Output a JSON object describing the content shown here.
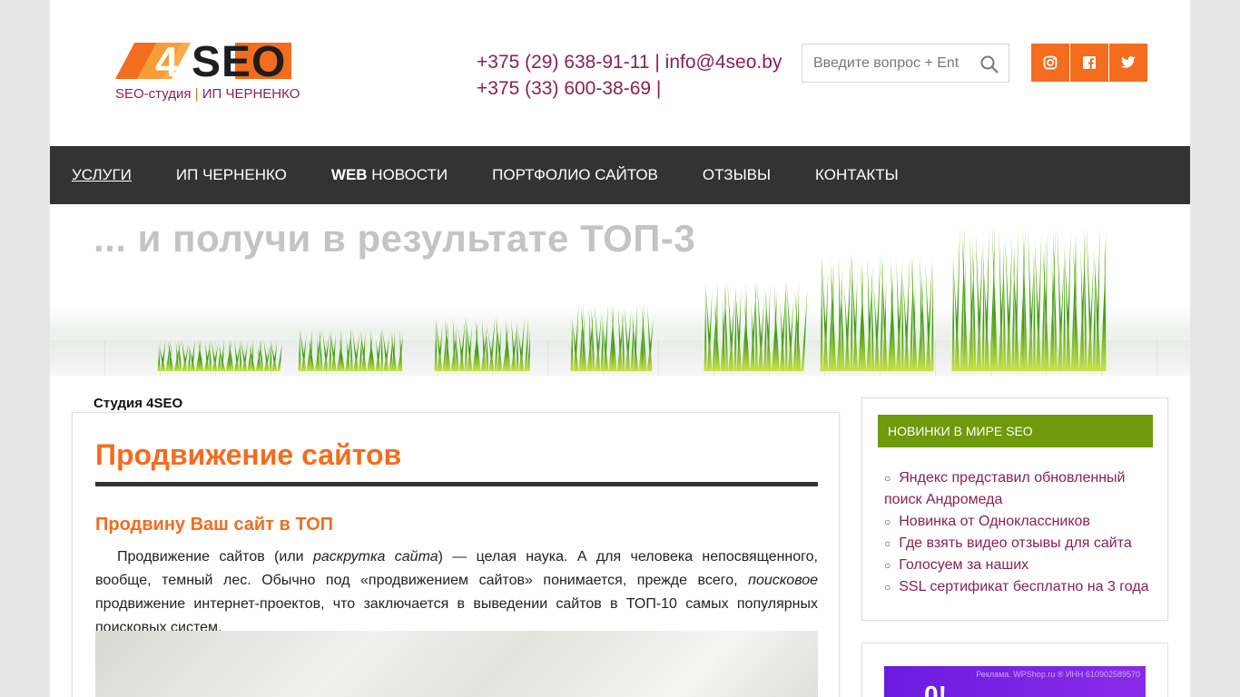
{
  "header": {
    "logo_sub_left": "SEO-студия",
    "logo_sub_sep": "|",
    "logo_sub_right": "ИП ЧЕРНЕНКО",
    "phone1": "+375 (29) 638-91-11",
    "email": "info@4seo.by",
    "phone2": "+375 (33) 600-38-69",
    "pipe": "|",
    "search_placeholder": "Введите вопрос + Ent",
    "social": [
      "instagram-icon",
      "facebook-icon",
      "twitter-icon"
    ],
    "accent_color": "#f46c1e",
    "link_color": "#8c1f55"
  },
  "nav": {
    "items": [
      {
        "label": "УСЛУГИ"
      },
      {
        "label": "ИП ЧЕРНЕНКО"
      },
      {
        "label_bold": "WEB",
        "label": " НОВОСТИ"
      },
      {
        "label": "ПОРТФОЛИО САЙТОВ"
      },
      {
        "label": "ОТЗЫВЫ"
      },
      {
        "label": "КОНТАКТЫ"
      }
    ],
    "background": "#333333"
  },
  "banner": {
    "text": "... и получи в результате ТОП-3"
  },
  "main": {
    "breadcrumb": "Студия 4SEO",
    "title": "Продвижение сайтов",
    "subtitle": "Продвину Ваш сайт в ТОП",
    "para_1": "Продвижение сайтов (или ",
    "para_em1": "раскрутка сайта",
    "para_2": ") — целая наука. А для человека непосвященного, вообще, темный лес. Обычно под «продвижением сайтов» понимается, прежде всего, ",
    "para_em2": "поисковое",
    "para_3": " продвижение интернет-проектов, что заключается в выведении сайтов в ТОП-10 самых популярных поисковых систем."
  },
  "sidebar": {
    "widget_title": "НОВИНКИ В МИРЕ SEO",
    "widget_color": "#6e9a0c",
    "links": [
      "Яндекс представил обновленный поиск Андромеда",
      "Новинка от Одноклассников",
      "Где взять видео отзывы для сайта",
      "Голосуем за наших",
      "SSL сертификат бесплатно на 3 года"
    ],
    "ad_label": "Реклама. WPShop.ru ® ИНН 610902589570"
  }
}
